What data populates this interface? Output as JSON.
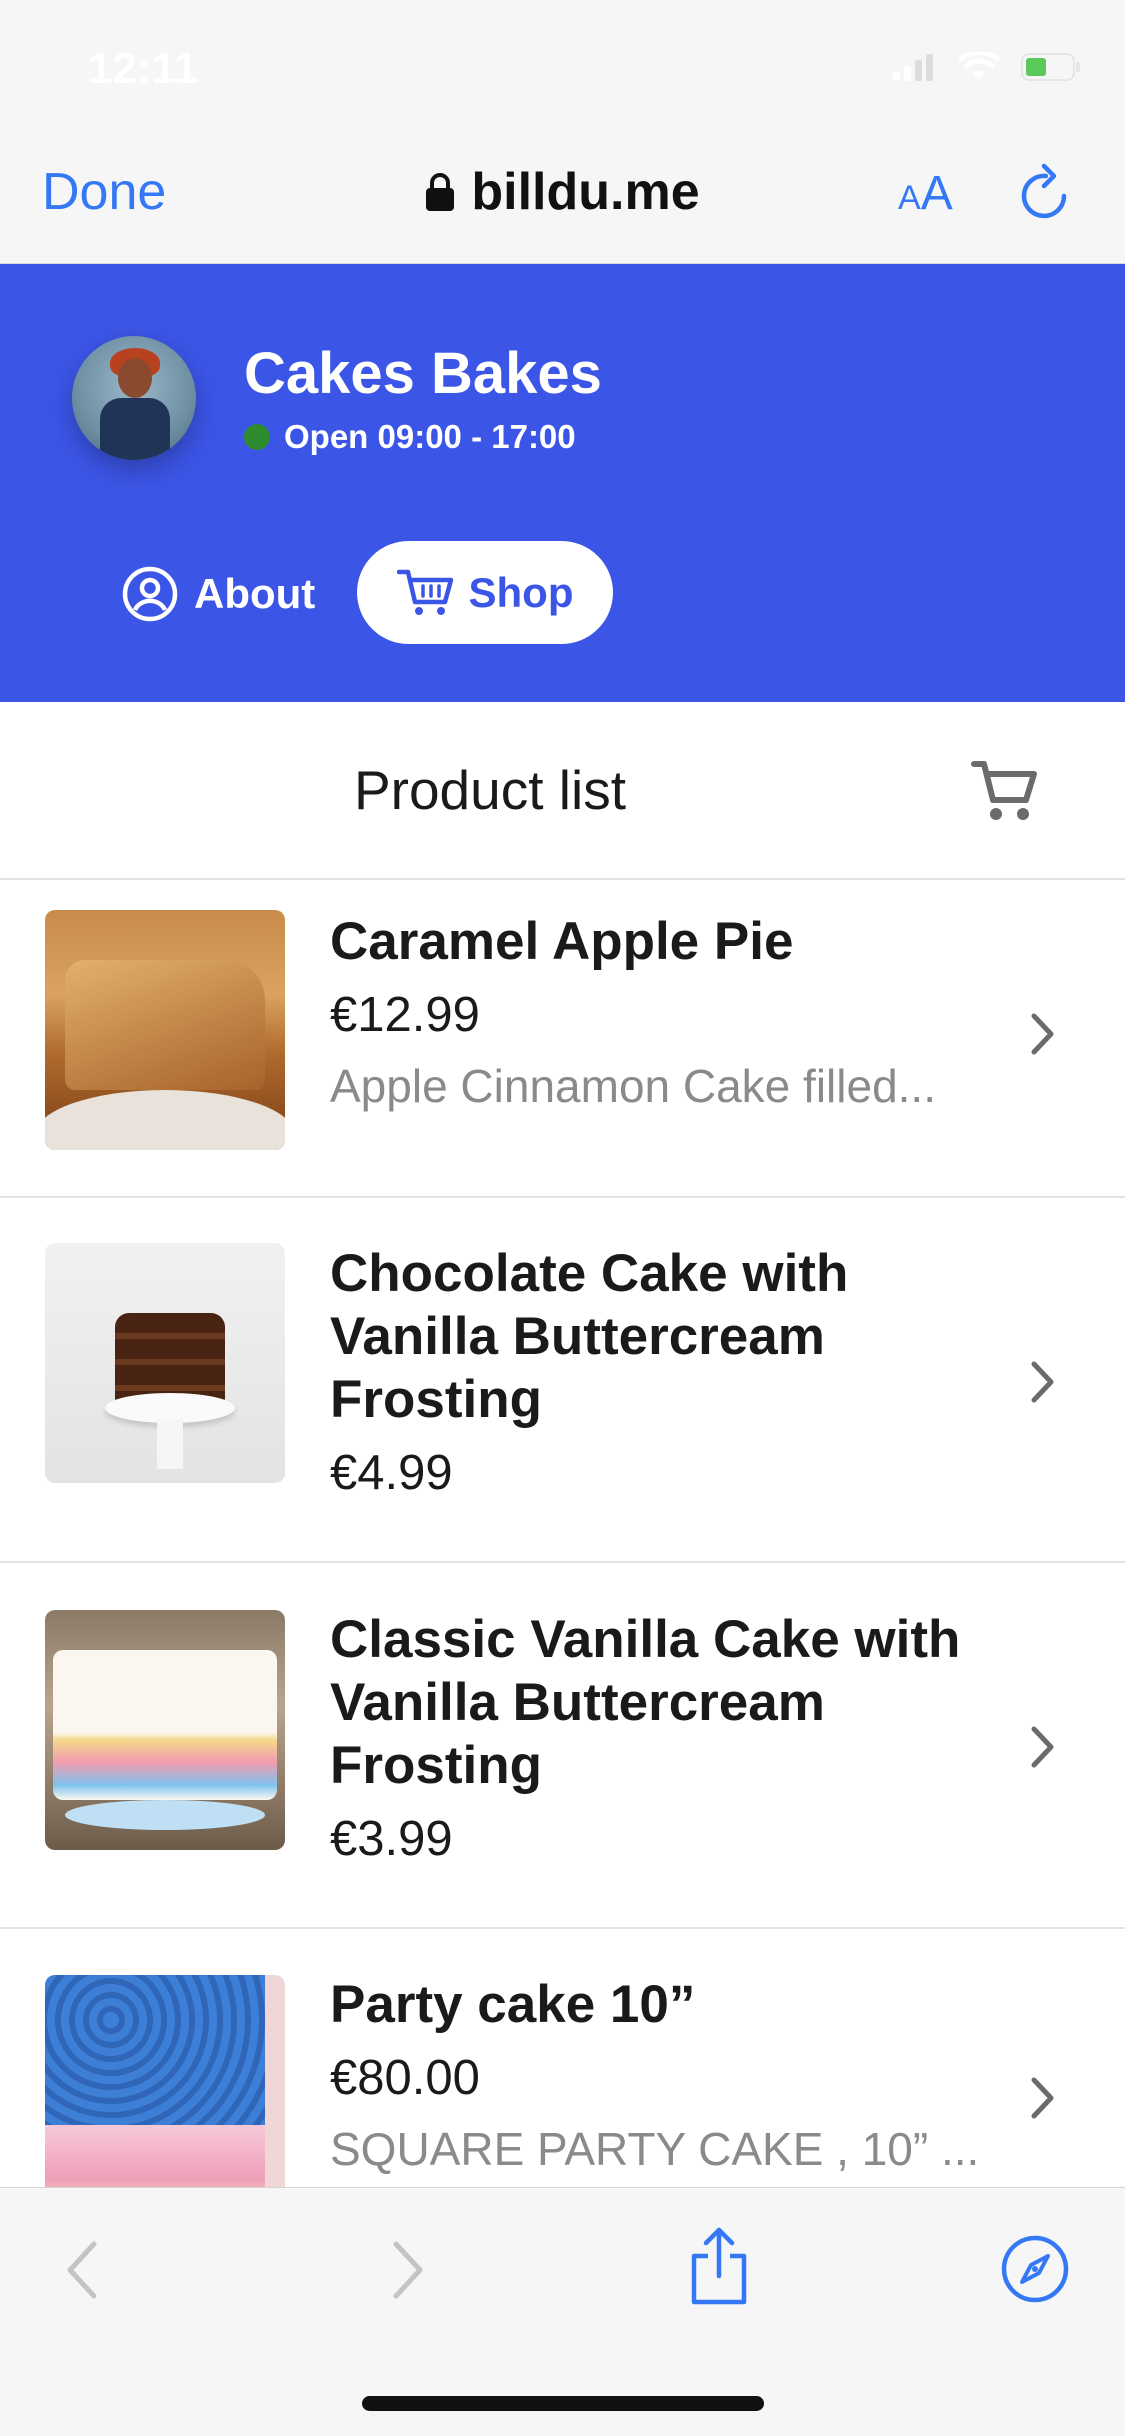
{
  "status_bar": {
    "time": "12:11"
  },
  "browser": {
    "done_label": "Done",
    "url": "billdu.me",
    "aa_small": "A",
    "aa_large": "A"
  },
  "shop": {
    "name": "Cakes Bakes",
    "open_hours": "Open 09:00 - 17:00",
    "tabs": [
      {
        "label": "About"
      },
      {
        "label": "Shop"
      }
    ],
    "accent_color": "#3b55e6"
  },
  "product_list": {
    "title": "Product list",
    "items": [
      {
        "name": "Caramel Apple Pie",
        "price": "€12.99",
        "description": "Apple Cinnamon Cake filled..."
      },
      {
        "name": "Chocolate Cake with Vanilla Buttercream Frosting",
        "price": "€4.99",
        "description": ""
      },
      {
        "name": "Classic Vanilla Cake with Vanilla Buttercream Frosting",
        "price": "€3.99",
        "description": ""
      },
      {
        "name": "Party cake 10”",
        "price": "€80.00",
        "description": "SQUARE PARTY CAKE , 10” ..."
      }
    ]
  }
}
